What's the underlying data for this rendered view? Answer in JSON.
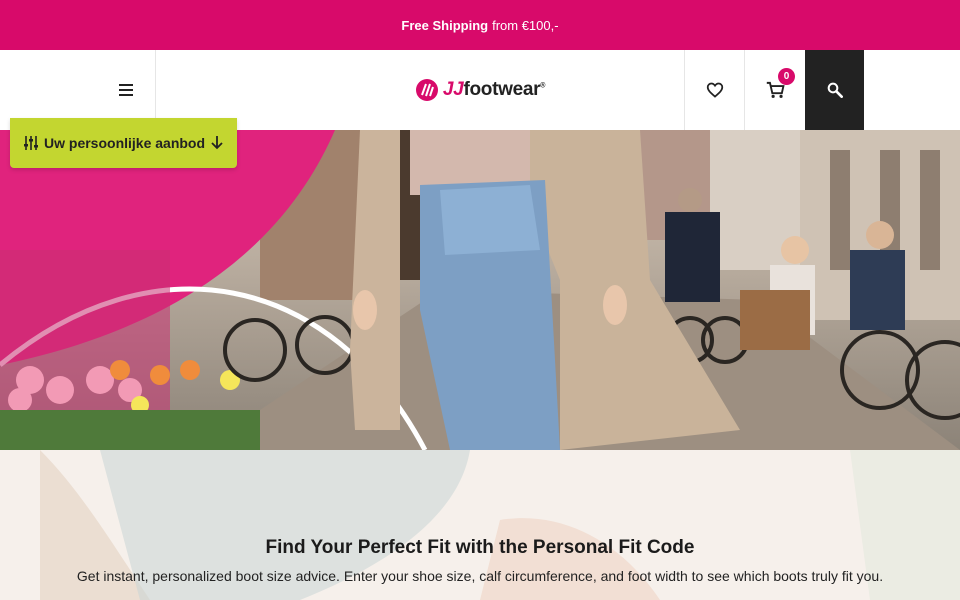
{
  "promo": {
    "bold": "Free Shipping",
    "rest": "from €100,-"
  },
  "header": {
    "logo_prefix": "JJ",
    "logo_name": "footwear",
    "logo_mark": "®",
    "cart_count": "0",
    "icons": {
      "menu": "hamburger-icon",
      "wishlist": "heart-icon",
      "cart": "cart-icon",
      "search": "search-icon"
    }
  },
  "offer": {
    "label": "Uw persoonlijke aanbod",
    "icon_left": "sliders-icon",
    "icon_right": "arrow-down-icon"
  },
  "fit": {
    "title": "Find Your Perfect Fit with the Personal Fit Code",
    "text": "Get instant, personalized boot size advice. Enter your shoe size, calf circumference, and foot width to see which boots truly fit you."
  },
  "colors": {
    "brand": "#d80a6a",
    "accent": "#c3d630",
    "dark": "#222222"
  }
}
